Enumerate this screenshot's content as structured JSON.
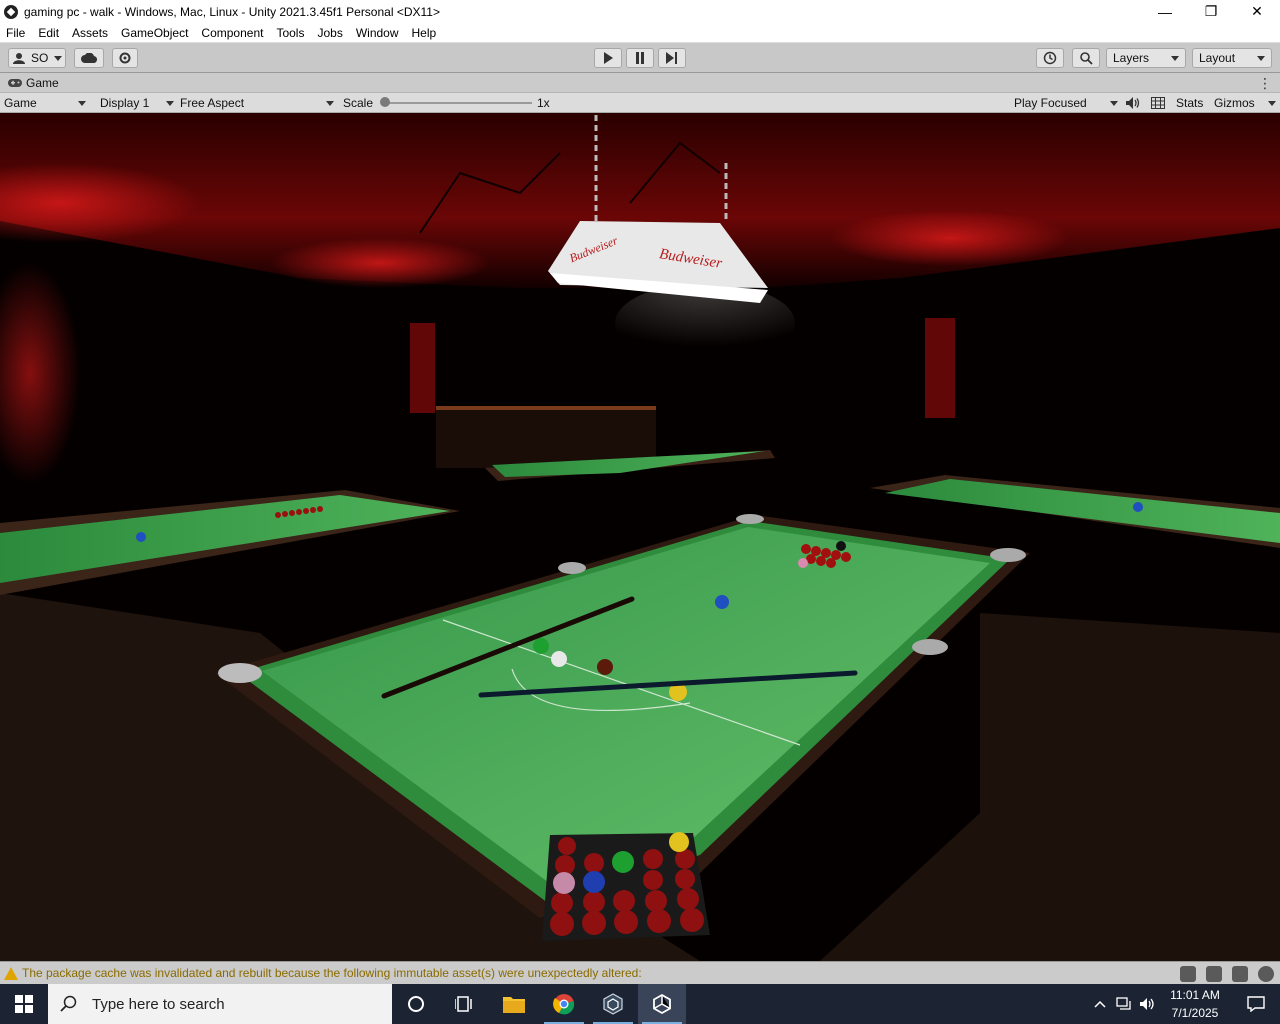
{
  "window": {
    "title": "gaming pc - walk - Windows, Mac, Linux - Unity 2021.3.45f1 Personal <DX11>",
    "minimize": "—",
    "maximize": "❐",
    "close": "✕"
  },
  "menu": {
    "items": [
      "File",
      "Edit",
      "Assets",
      "GameObject",
      "Component",
      "Tools",
      "Jobs",
      "Window",
      "Help"
    ]
  },
  "toolbar": {
    "account_label": "SO",
    "layers_label": "Layers",
    "layout_label": "Layout"
  },
  "game_tab": {
    "label": "Game",
    "more": "⋮"
  },
  "game_bar": {
    "view_select": "Game",
    "display_select": "Display 1",
    "aspect_select": "Free Aspect",
    "scale_label": "Scale",
    "scale_value": "1x",
    "play_mode_select": "Play Focused",
    "stats_label": "Stats",
    "gizmos_label": "Gizmos",
    "scale_level": 0.0
  },
  "viewport": {
    "lamp_text": "Budweiser"
  },
  "status": {
    "message": "The package cache was invalidated and rebuilt because the following immutable asset(s) were unexpectedly altered:"
  },
  "taskbar": {
    "search_placeholder": "Type here to search",
    "time": "11:01 AM",
    "date": "7/1/2025"
  },
  "colors": {
    "felt": "#3a9a47",
    "warning": "#e0a400",
    "taskbar": "#1c2433"
  }
}
